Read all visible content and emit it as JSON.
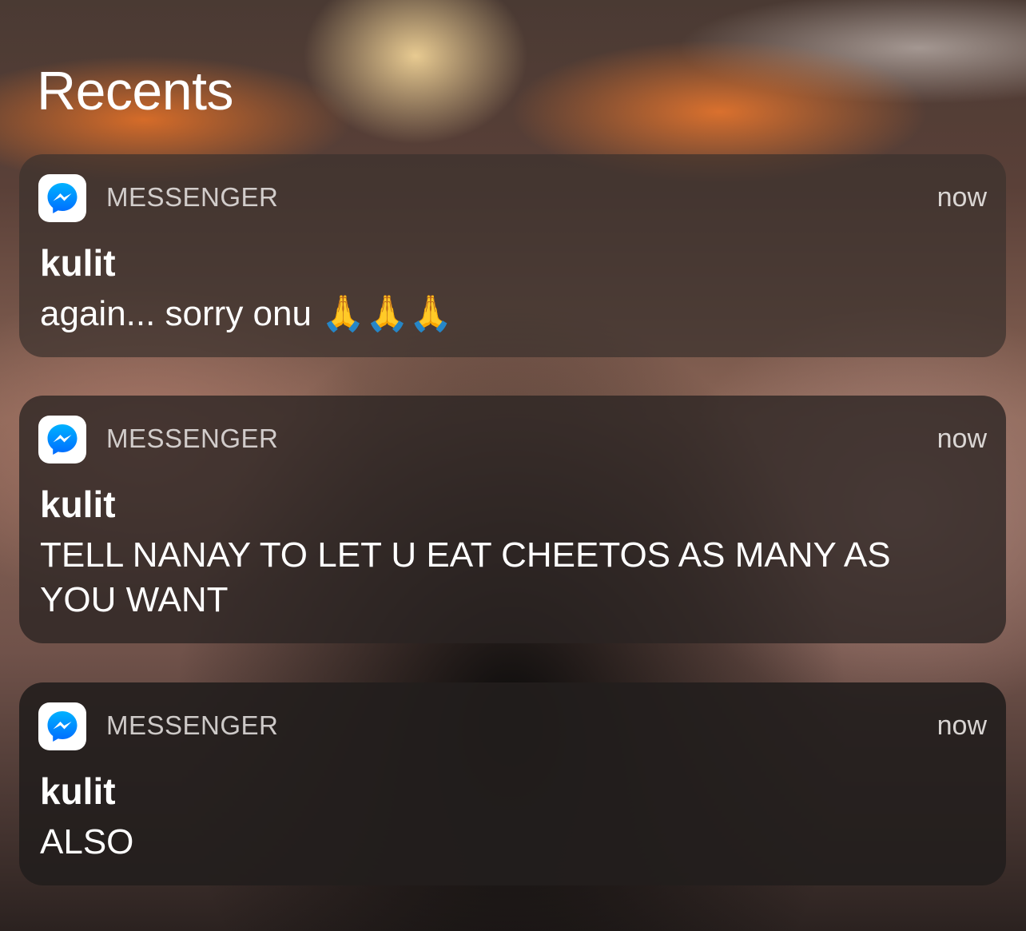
{
  "header": {
    "title": "Recents"
  },
  "notifications": [
    {
      "app": "MESSENGER",
      "app_icon": "messenger-icon",
      "time": "now",
      "sender": "kulit",
      "message": "again... sorry onu 🙏🙏🙏"
    },
    {
      "app": "MESSENGER",
      "app_icon": "messenger-icon",
      "time": "now",
      "sender": "kulit",
      "message": "TELL NANAY TO LET U EAT CHEETOS AS MANY AS YOU WANT"
    },
    {
      "app": "MESSENGER",
      "app_icon": "messenger-icon",
      "time": "now",
      "sender": "kulit",
      "message": "ALSO"
    }
  ],
  "colors": {
    "messenger_blue": "#0a7cff",
    "text": "#ffffff"
  }
}
